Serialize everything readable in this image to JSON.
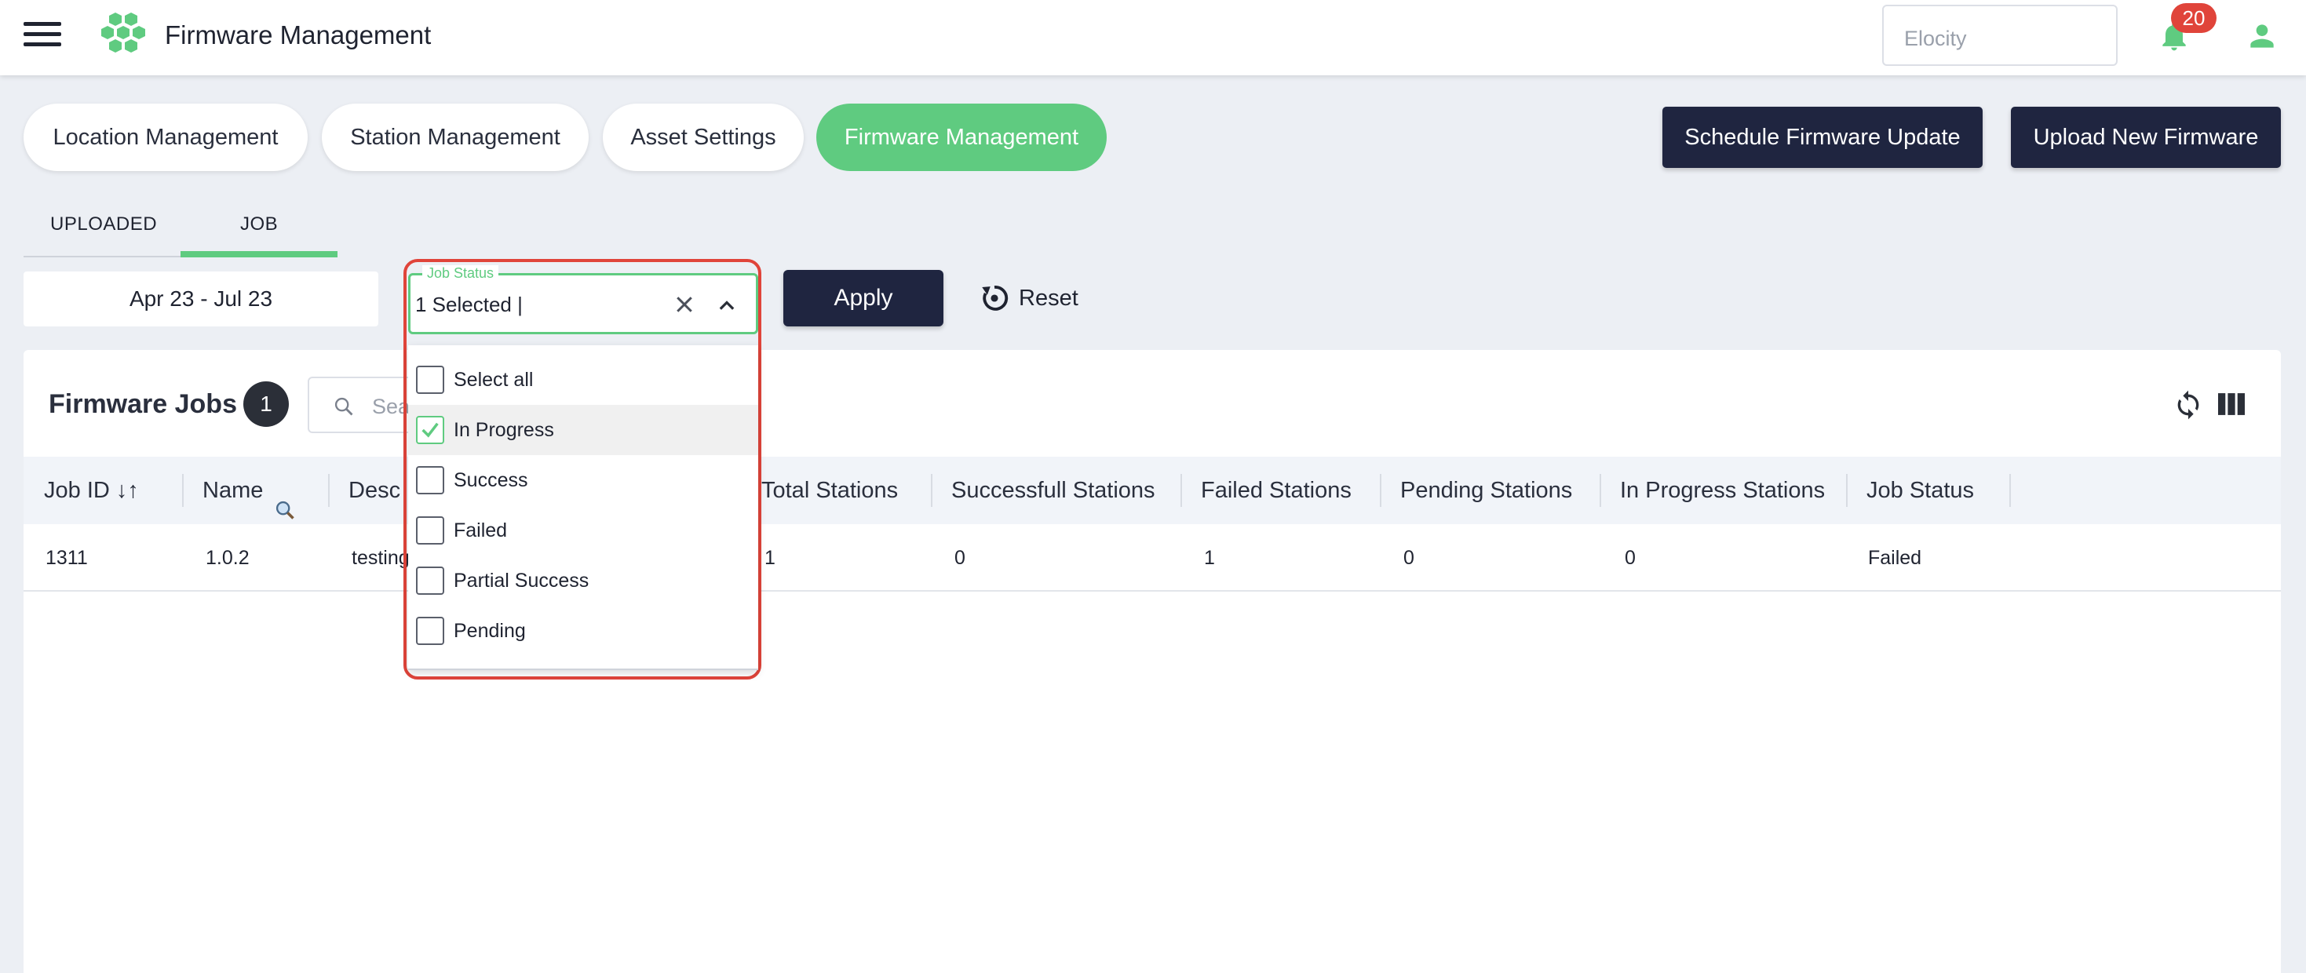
{
  "header": {
    "app_title": "Firmware Management",
    "org_placeholder": "Elocity",
    "notification_count": "20",
    "brand_color": "#5fcb80"
  },
  "nav": {
    "pills": [
      {
        "label": "Location Management",
        "active": false
      },
      {
        "label": "Station Management",
        "active": false
      },
      {
        "label": "Asset Settings",
        "active": false
      },
      {
        "label": "Firmware Management",
        "active": true
      }
    ],
    "actions": {
      "schedule": "Schedule Firmware Update",
      "upload": "Upload New Firmware"
    }
  },
  "tabs": [
    {
      "label": "UPLOADED",
      "active": false
    },
    {
      "label": "JOB",
      "active": true
    }
  ],
  "filters": {
    "date_range": "Apr 23 - Jul 23",
    "job_status": {
      "legend": "Job Status",
      "value": "1 Selected |",
      "options": [
        {
          "label": "Select all",
          "checked": false
        },
        {
          "label": "In Progress",
          "checked": true
        },
        {
          "label": "Success",
          "checked": false
        },
        {
          "label": "Failed",
          "checked": false
        },
        {
          "label": "Partial Success",
          "checked": false
        },
        {
          "label": "Pending",
          "checked": false
        }
      ]
    },
    "apply_label": "Apply",
    "reset_label": "Reset"
  },
  "table": {
    "title": "Firmware Jobs",
    "count": "1",
    "search_placeholder": "Sea",
    "columns": [
      "Job ID ↓↑",
      "Name",
      "Desc",
      "Total Stations",
      "Successfull Stations",
      "Failed Stations",
      "Pending Stations",
      "In Progress Stations",
      "Job Status"
    ],
    "rows": [
      [
        "1311",
        "1.0.2",
        "testing",
        "1",
        "0",
        "1",
        "0",
        "0",
        "Failed"
      ]
    ]
  }
}
